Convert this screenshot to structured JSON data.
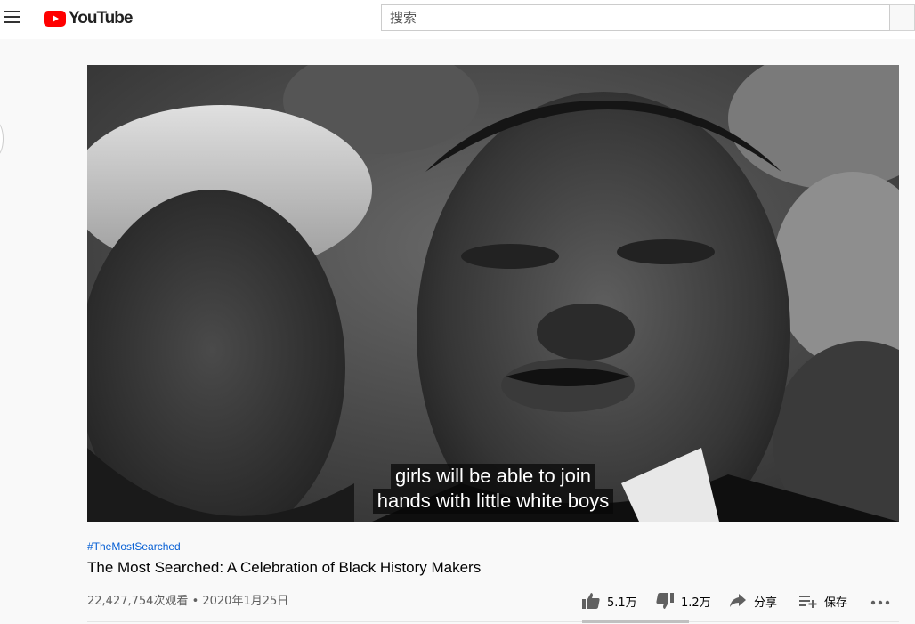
{
  "header": {
    "brand": "YouTube",
    "search_placeholder": "搜索"
  },
  "video": {
    "caption_lines": [
      "girls will be able to join",
      "hands with little white boys"
    ],
    "hashtag": "#TheMostSearched",
    "title": "The Most Searched: A Celebration of Black History Makers",
    "views_date": "22,427,754次观看 • 2020年1月25日"
  },
  "actions": {
    "like_count": "5.1万",
    "dislike_count": "1.2万",
    "share_label": "分享",
    "save_label": "保存"
  },
  "icons": [
    "menu-icon",
    "youtube-logo-icon",
    "thumb-up-icon",
    "thumb-down-icon",
    "share-arrow-icon",
    "playlist-add-icon",
    "more-icon"
  ]
}
